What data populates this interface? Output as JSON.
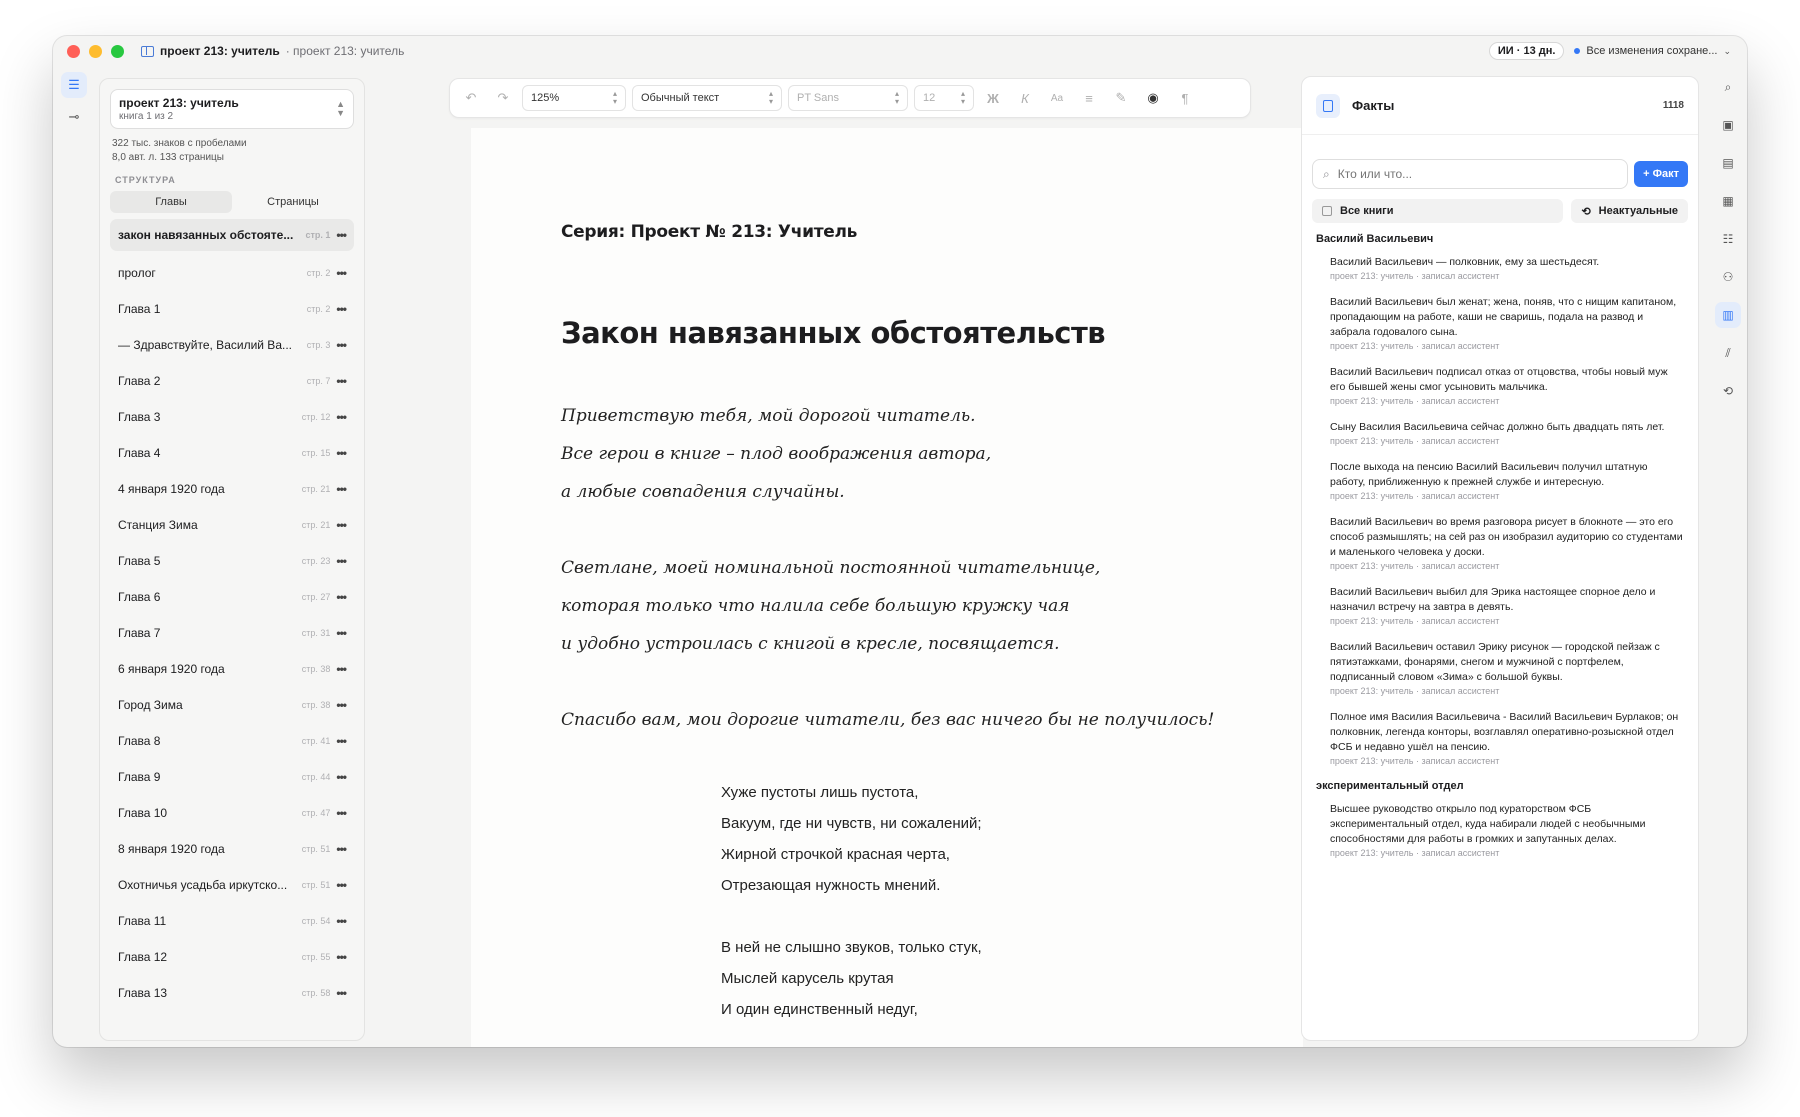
{
  "window": {
    "title_bold": "проект 213: учитель",
    "title_sub": "· проект 213: учитель",
    "ai_badge": "ИИ · 13 дн.",
    "save_status": "Все изменения сохране..."
  },
  "sidebar": {
    "project_name": "проект 213: учитель",
    "project_sub": "книга 1 из 2",
    "stats_line1": "322 тыс. знаков с пробелами",
    "stats_line2": "8,0 авт. л.  133 страницы",
    "structure_label": "СТРУКТУРА",
    "tabs": [
      "Главы",
      "Страницы"
    ],
    "chapters": [
      {
        "name": "закон навязанных обстояте...",
        "page": "стр. 1"
      },
      {
        "name": "пролог",
        "page": "стр. 2"
      },
      {
        "name": "Глава 1",
        "page": "стр. 2"
      },
      {
        "name": "— Здравствуйте, Василий Ва...",
        "page": "стр. 3"
      },
      {
        "name": "Глава 2",
        "page": "стр. 7"
      },
      {
        "name": "Глава 3",
        "page": "стр. 12"
      },
      {
        "name": "Глава 4",
        "page": "стр. 15"
      },
      {
        "name": "4 января 1920 года",
        "page": "стр. 21"
      },
      {
        "name": "Станция Зима",
        "page": "стр. 21"
      },
      {
        "name": "Глава 5",
        "page": "стр. 23"
      },
      {
        "name": "Глава 6",
        "page": "стр. 27"
      },
      {
        "name": "Глава 7",
        "page": "стр. 31"
      },
      {
        "name": "6 января 1920 года",
        "page": "стр. 38"
      },
      {
        "name": "Город Зима",
        "page": "стр. 38"
      },
      {
        "name": "Глава 8",
        "page": "стр. 41"
      },
      {
        "name": "Глава 9",
        "page": "стр. 44"
      },
      {
        "name": "Глава 10",
        "page": "стр. 47"
      },
      {
        "name": "8 января 1920 года",
        "page": "стр. 51"
      },
      {
        "name": "Охотничья усадьба иркутско...",
        "page": "стр. 51"
      },
      {
        "name": "Глава 11",
        "page": "стр. 54"
      },
      {
        "name": "Глава 12",
        "page": "стр. 55"
      },
      {
        "name": "Глава 13",
        "page": "стр. 58"
      }
    ]
  },
  "toolbar": {
    "zoom": "125%",
    "style": "Обычный текст",
    "font": "PT Sans",
    "size": "12",
    "bold": "Ж",
    "italic": "К",
    "case": "Aa"
  },
  "editor": {
    "series": "Серия: Проект № 213: Учитель",
    "chapter_title": "Закон навязанных обстоятельств",
    "paragraphs": [
      "Приветствую тебя, мой дорогой читатель.",
      "Все герои в книге – плод воображения автора,",
      "а любые совпадения случайны.",
      "Светлане, моей номинальной постоянной читательнице,",
      "которая только что налила себе большую кружку чая",
      "и удобно устроилась с книгой в кресле, посвящается.",
      "Спасибо вам, мои дорогие читатели, без вас ничего бы не получилось!"
    ],
    "poem": [
      "Хуже пустоты лишь пустота,",
      "Вакуум, где ни чувств, ни сожалений;",
      "Жирной строчкой красная черта,",
      "Отрезающая нужность мнений.",
      "В ней не слышно звуков, только стук,",
      "Мыслей карусель крутая",
      "И один единственный недуг,"
    ]
  },
  "facts": {
    "title": "Факты",
    "count": "1118",
    "search_placeholder": "Кто или что...",
    "add_label": "+ Факт",
    "filter_all": "Все книги",
    "filter_outdated": "Неактуальные",
    "groups": [
      {
        "title": "Василий Васильевич",
        "items": [
          {
            "text": "Василий Васильевич — полковник, ему за шестьдесят.",
            "meta": "проект 213: учитель · записал ассистент"
          },
          {
            "text": "Василий Васильевич был женат; жена, поняв, что с нищим капитаном, пропадающим на работе, каши не сваришь, подала на развод и забрала годовалого сына.",
            "meta": "проект 213: учитель · записал ассистент"
          },
          {
            "text": "Василий Васильевич подписал отказ от отцовства, чтобы новый муж его бывшей жены смог усыновить мальчика.",
            "meta": "проект 213: учитель · записал ассистент"
          },
          {
            "text": "Сыну Василия Васильевича сейчас должно быть двадцать пять лет.",
            "meta": "проект 213: учитель · записал ассистент"
          },
          {
            "text": "После выхода на пенсию Василий Васильевич получил штатную работу, приближенную к прежней службе и интересную.",
            "meta": "проект 213: учитель · записал ассистент"
          },
          {
            "text": "Василий Васильевич во время разговора рисует в блокноте — это его способ размышлять; на сей раз он изобразил аудиторию со студентами и маленького человека у доски.",
            "meta": "проект 213: учитель · записал ассистент"
          },
          {
            "text": "Василий Васильевич выбил для Эрика настоящее спорное дело и назначил встречу на завтра в девять.",
            "meta": "проект 213: учитель · записал ассистент"
          },
          {
            "text": "Василий Васильевич оставил Эрику рисунок — городской пейзаж с пятиэтажками, фонарями, снегом и мужчиной с портфелем, подписанный словом «Зима» с большой буквы.",
            "meta": "проект 213: учитель · записал ассистент"
          },
          {
            "text": "Полное имя Василия Васильевича - Василий Васильевич Бурлаков; он полковник, легенда конторы, возглавлял оперативно-розыскной отдел ФСБ и недавно ушёл на пенсию.",
            "meta": "проект 213: учитель · записал ассистент"
          }
        ]
      },
      {
        "title": "экспериментальный отдел",
        "items": [
          {
            "text": "Высшее руководство открыло под кураторством ФСБ экспериментальный отдел, куда набирали людей с необычными способностями для работы в громких и запутанных делах.",
            "meta": "проект 213: учитель · записал ассистент"
          }
        ]
      }
    ]
  },
  "colors": {
    "accent": "#3478f6",
    "traffic_red": "#ff5f57",
    "traffic_yellow": "#febc2e",
    "traffic_green": "#28c840"
  }
}
